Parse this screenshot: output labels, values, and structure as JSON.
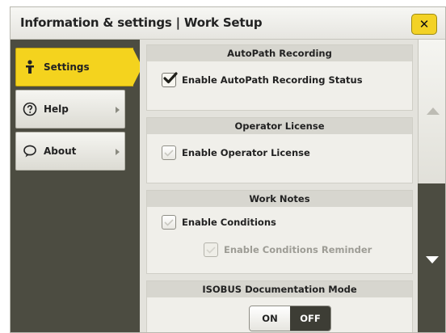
{
  "window": {
    "title": "Information & settings | Work Setup",
    "close_label": "✕"
  },
  "sidebar": {
    "items": [
      {
        "label": "Settings",
        "icon": "person-icon",
        "active": true
      },
      {
        "label": "Help",
        "icon": "question-icon",
        "active": false
      },
      {
        "label": "About",
        "icon": "speech-bubble-icon",
        "active": false
      }
    ]
  },
  "sections": {
    "autopath": {
      "header": "AutoPath Recording",
      "enable_status": {
        "label": "Enable AutoPath Recording Status",
        "checked": true
      }
    },
    "operator": {
      "header": "Operator License",
      "enable_license": {
        "label": "Enable Operator License",
        "checked": false
      }
    },
    "work_notes": {
      "header": "Work Notes",
      "enable_conditions": {
        "label": "Enable Conditions",
        "checked": false
      },
      "enable_reminder": {
        "label": "Enable Conditions Reminder",
        "checked": false,
        "disabled": true
      }
    },
    "isobus": {
      "header": "ISOBUS Documentation Mode",
      "on_label": "ON",
      "off_label": "OFF",
      "selected": "OFF"
    }
  },
  "colors": {
    "accent_yellow": "#f4d31e",
    "sidebar_dark": "#4c4c41",
    "panel_bg": "#e3e2dc",
    "toggle_selected": "#3d3d35"
  }
}
